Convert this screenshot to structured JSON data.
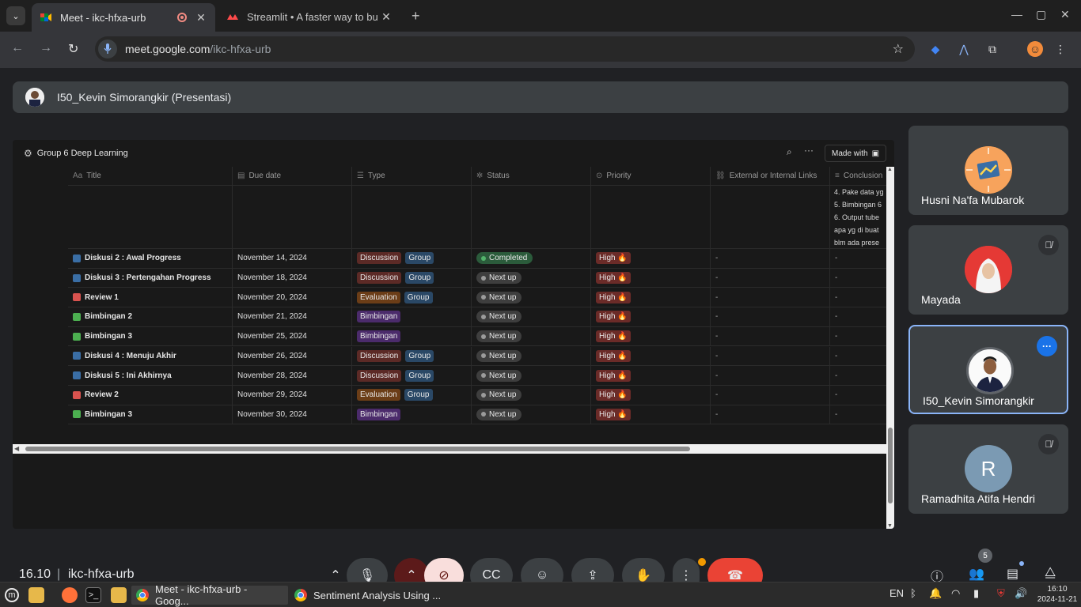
{
  "browser": {
    "tabs": [
      {
        "title": "Meet - ikc-hfxa-urb",
        "active": true
      },
      {
        "title": "Streamlit • A faster way to bu",
        "active": false
      }
    ],
    "url_host": "meet.google.com",
    "url_path": "/ikc-hfxa-urb"
  },
  "meet": {
    "presenter_label": "I50_Kevin Simorangkir (Presentasi)",
    "meeting_time": "16.10",
    "meeting_code": "ikc-hfxa-urb",
    "participant_count": "5",
    "participants": [
      {
        "name": "Husni Na'fa Mubarok",
        "muted": false,
        "avatar": "illustration"
      },
      {
        "name": "Mayada",
        "muted": true,
        "avatar": "photo"
      },
      {
        "name": "I50_Kevin Simorangkir",
        "muted": false,
        "avatar": "photo",
        "active": true
      },
      {
        "name": "Ramadhita Atifa Hendri",
        "muted": true,
        "avatar": "R",
        "avatar_color": "#7b9ab3"
      }
    ]
  },
  "notion": {
    "workspace_name": "Group 6 Deep Learning",
    "made_with_label": "Made with",
    "columns": [
      "Title",
      "Due date",
      "Type",
      "Status",
      "Priority",
      "External or Internal Links",
      "Conclusion"
    ],
    "conclusion_lines": [
      "4. Pake data yg",
      "5. Bimbingan 6",
      "6. Output tube",
      "apa yg di buat",
      "blm ada prese"
    ],
    "rows": [
      {
        "title": "Diskusi 2 : Awal Progress",
        "icon_color": "#3a6ea5",
        "due": "November 14, 2024",
        "types": [
          "Discussion",
          "Group"
        ],
        "status": "Completed",
        "priority": "High 🔥",
        "links": "-",
        "conclusion": "-"
      },
      {
        "title": "Diskusi 3 : Pertengahan Progress",
        "icon_color": "#3a6ea5",
        "due": "November 18, 2024",
        "types": [
          "Discussion",
          "Group"
        ],
        "status": "Next up",
        "priority": "High 🔥",
        "links": "-",
        "conclusion": "-"
      },
      {
        "title": "Review 1",
        "icon_color": "#d9534f",
        "due": "November 20, 2024",
        "types": [
          "Evaluation",
          "Group"
        ],
        "status": "Next up",
        "priority": "High 🔥",
        "links": "-",
        "conclusion": "-"
      },
      {
        "title": "Bimbingan 2",
        "icon_color": "#4caf50",
        "due": "November 21, 2024",
        "types": [
          "Bimbingan"
        ],
        "status": "Next up",
        "priority": "High 🔥",
        "links": "-",
        "conclusion": "-"
      },
      {
        "title": "Bimbingan 3",
        "icon_color": "#4caf50",
        "due": "November 25, 2024",
        "types": [
          "Bimbingan"
        ],
        "status": "Next up",
        "priority": "High 🔥",
        "links": "-",
        "conclusion": "-"
      },
      {
        "title": "Diskusi 4 : Menuju Akhir",
        "icon_color": "#3a6ea5",
        "due": "November 26, 2024",
        "types": [
          "Discussion",
          "Group"
        ],
        "status": "Next up",
        "priority": "High 🔥",
        "links": "-",
        "conclusion": "-"
      },
      {
        "title": "Diskusi 5 : Ini Akhirnya",
        "icon_color": "#3a6ea5",
        "due": "November 28, 2024",
        "types": [
          "Discussion",
          "Group"
        ],
        "status": "Next up",
        "priority": "High 🔥",
        "links": "-",
        "conclusion": "-"
      },
      {
        "title": "Review 2",
        "icon_color": "#d9534f",
        "due": "November 29, 2024",
        "types": [
          "Evaluation",
          "Group"
        ],
        "status": "Next up",
        "priority": "High 🔥",
        "links": "-",
        "conclusion": "-"
      },
      {
        "title": "Bimbingan 3",
        "icon_color": "#4caf50",
        "due": "November 30, 2024",
        "types": [
          "Bimbingan"
        ],
        "status": "Next up",
        "priority": "High 🔥",
        "links": "-",
        "conclusion": "-"
      }
    ]
  },
  "taskbar": {
    "windows": [
      "Meet - ikc-hfxa-urb - Goog...",
      "Sentiment Analysis Using ..."
    ],
    "lang": "EN",
    "time": "16:10",
    "date": "2024-11-21"
  }
}
